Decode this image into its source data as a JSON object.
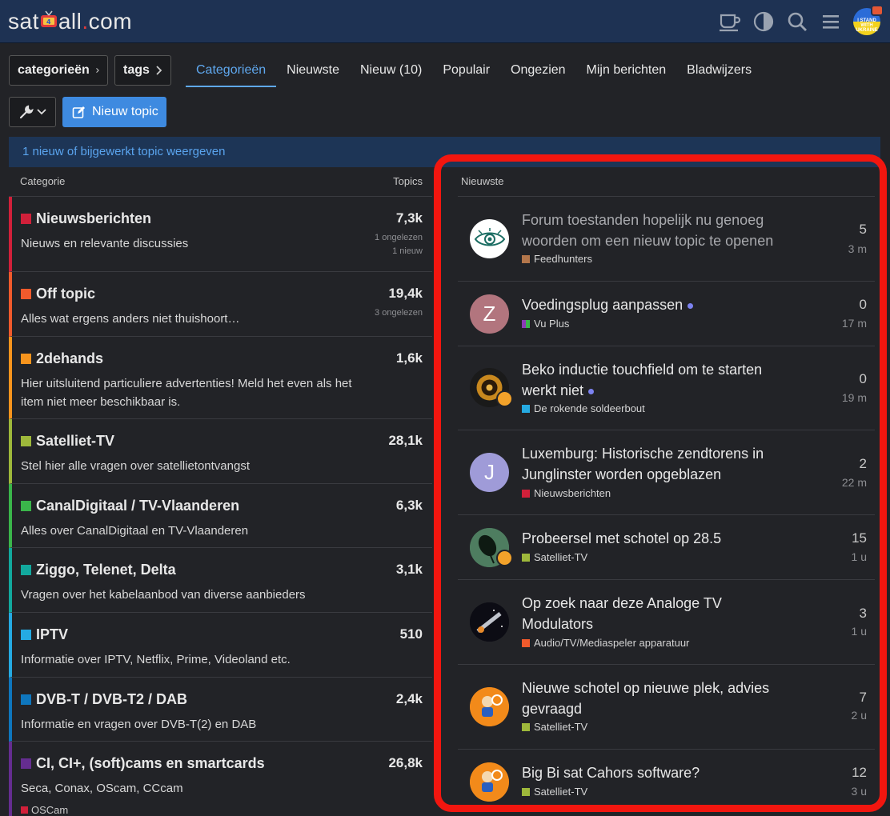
{
  "header": {
    "logo": {
      "prefix": "sat",
      "suffix": "all",
      "dot": ".",
      "tld": "com"
    },
    "icons": [
      "cup-icon",
      "theme-toggle-icon",
      "search-icon",
      "hamburger-menu-icon"
    ],
    "avatar_text": "I STAND WITH UKRAINE"
  },
  "nav": {
    "crumb_categories": "categorieën",
    "crumb_tags": "tags",
    "tabs": [
      "Categorieën",
      "Nieuwste",
      "Nieuw (10)",
      "Populair",
      "Ongezien",
      "Mijn berichten",
      "Bladwijzers"
    ],
    "active_tab": "Categorieën",
    "new_topic": "Nieuw topic"
  },
  "banner": "1 nieuw of bijgewerkt topic weergeven",
  "categories": {
    "header_left": "Categorie",
    "header_right": "Topics",
    "rows": [
      {
        "name": "Nieuwsberichten",
        "desc": "Nieuws en relevante discussies",
        "count": "7,3k",
        "meta1": "1 ongelezen",
        "meta2": "1 nieuw",
        "color": "#d1203a"
      },
      {
        "name": "Off topic",
        "desc": "Alles wat ergens anders niet thuishoort…",
        "count": "19,4k",
        "meta1": "3 ongelezen",
        "meta2": "",
        "color": "#f05a2c"
      },
      {
        "name": "2dehands",
        "desc": "Hier uitsluitend particuliere advertenties! Meld het even als het item niet meer beschikbaar is.",
        "count": "1,6k",
        "meta1": "",
        "meta2": "",
        "color": "#f7941d"
      },
      {
        "name": "Satelliet-TV",
        "desc": "Stel hier alle vragen over satellietontvangst",
        "count": "28,1k",
        "meta1": "",
        "meta2": "",
        "color": "#9eb83b"
      },
      {
        "name": "CanalDigitaal / TV-Vlaanderen",
        "desc": "Alles over CanalDigitaal en TV-Vlaanderen",
        "count": "6,3k",
        "meta1": "",
        "meta2": "",
        "color": "#3ab54a"
      },
      {
        "name": "Ziggo, Telenet, Delta",
        "desc": "Vragen over het kabelaanbod van diverse aanbieders",
        "count": "3,1k",
        "meta1": "",
        "meta2": "",
        "color": "#12a89d"
      },
      {
        "name": "IPTV",
        "desc": "Informatie over IPTV, Netflix, Prime, Videoland etc.",
        "count": "510",
        "meta1": "",
        "meta2": "",
        "color": "#25aae2"
      },
      {
        "name": "DVB-T / DVB-T2 / DAB",
        "desc": "Informatie en vragen over DVB-T(2) en DAB",
        "count": "2,4k",
        "meta1": "",
        "meta2": "",
        "color": "#0e76bd"
      },
      {
        "name": "CI, CI+, (soft)cams en smartcards",
        "desc": "Seca, Conax, OScam, CCcam",
        "count": "26,8k",
        "meta1": "",
        "meta2": "",
        "color": "#652d90",
        "sub": "OSCam",
        "sub_color": "#d1203a"
      }
    ]
  },
  "latest": {
    "header": "Nieuwste",
    "topics": [
      {
        "title": "Forum toestanden hopelijk nu genoeg woorden om een nieuw topic te openen",
        "category": "Feedhunters",
        "cat_color": "#b3764b",
        "replies": "5",
        "age": "3 m",
        "read": true,
        "avatar": "eye-logo"
      },
      {
        "title": "Voedingsplug aanpassen",
        "category": "Vu Plus",
        "cat_color": "#8c3ab5",
        "replies": "0",
        "age": "17 m",
        "read": false,
        "avatar_letter": "Z",
        "avatar_color": "#b2757e"
      },
      {
        "title": "Beko inductie touchfield om te starten werkt niet",
        "category": "De rokende soldeerbout",
        "cat_color": "#25aae2",
        "replies": "0",
        "age": "19 m",
        "read": false,
        "avatar": "badge-avatar"
      },
      {
        "title": "Luxemburg: Historische zendtorens in Junglinster worden opgeblazen",
        "category": "Nieuwsberichten",
        "cat_color": "#d1203a",
        "replies": "2",
        "age": "22 m",
        "read": false,
        "avatar_letter": "J",
        "avatar_color": "#9f9bd8"
      },
      {
        "title": "Probeersel met schotel op 28.5",
        "category": "Satelliet-TV",
        "cat_color": "#9eb83b",
        "replies": "15",
        "age": "1 u",
        "read": false,
        "avatar": "dish-avatar"
      },
      {
        "title": "Op zoek naar deze Analoge TV Modulators",
        "category": "Audio/TV/Mediaspeler apparatuur",
        "cat_color": "#f05a2c",
        "replies": "3",
        "age": "1 u",
        "read": false,
        "avatar": "space-avatar"
      },
      {
        "title": "Nieuwe schotel op nieuwe plek, advies gevraagd",
        "category": "Satelliet-TV",
        "cat_color": "#9eb83b",
        "replies": "7",
        "age": "2 u",
        "read": false,
        "avatar": "cartoon-avatar"
      },
      {
        "title": "Big Bi sat Cahors software?",
        "category": "Satelliet-TV",
        "cat_color": "#9eb83b",
        "replies": "12",
        "age": "3 u",
        "read": false,
        "avatar": "cartoon-avatar"
      }
    ]
  }
}
